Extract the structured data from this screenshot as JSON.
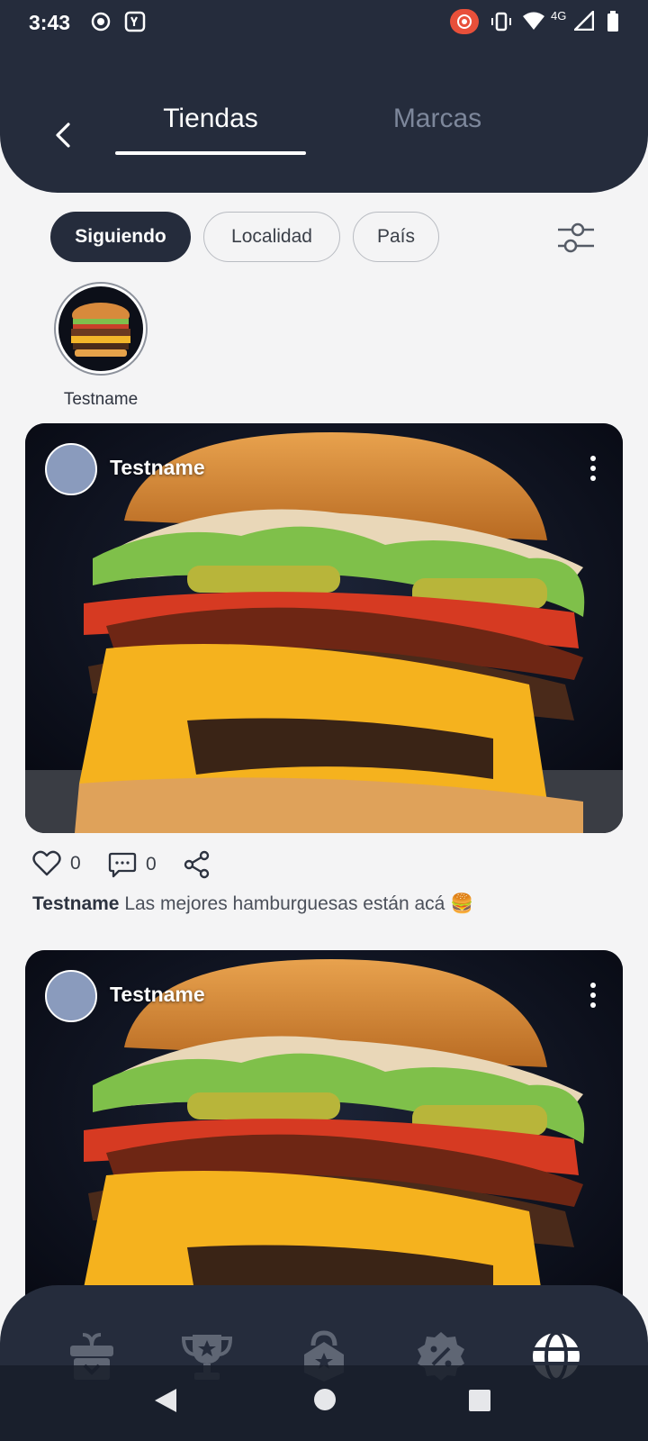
{
  "status_bar": {
    "time": "3:43",
    "network": "4G"
  },
  "header": {
    "tabs": [
      {
        "label": "Tiendas",
        "active": true
      },
      {
        "label": "Marcas",
        "active": false
      }
    ]
  },
  "filters": {
    "chips": [
      {
        "label": "Siguiendo",
        "active": true
      },
      {
        "label": "Localidad",
        "active": false
      },
      {
        "label": "País",
        "active": false
      }
    ]
  },
  "stories": [
    {
      "name": "Testname"
    }
  ],
  "posts": [
    {
      "author": "Testname",
      "likes": "0",
      "comments": "0",
      "caption_author": "Testname",
      "caption_text": " Las mejores hamburguesas están acá 🍔"
    },
    {
      "author": "Testname"
    }
  ],
  "bottom_nav": {
    "items": [
      "gift-icon",
      "trophy-icon",
      "shop-star-icon",
      "discount-badge-icon",
      "globe-icon"
    ],
    "active_index": 4
  },
  "colors": {
    "primary_dark": "#252c3c",
    "background": "#f4f4f5",
    "inactive_tab": "#7d879b",
    "avatar_placeholder": "#8a9bbd"
  }
}
